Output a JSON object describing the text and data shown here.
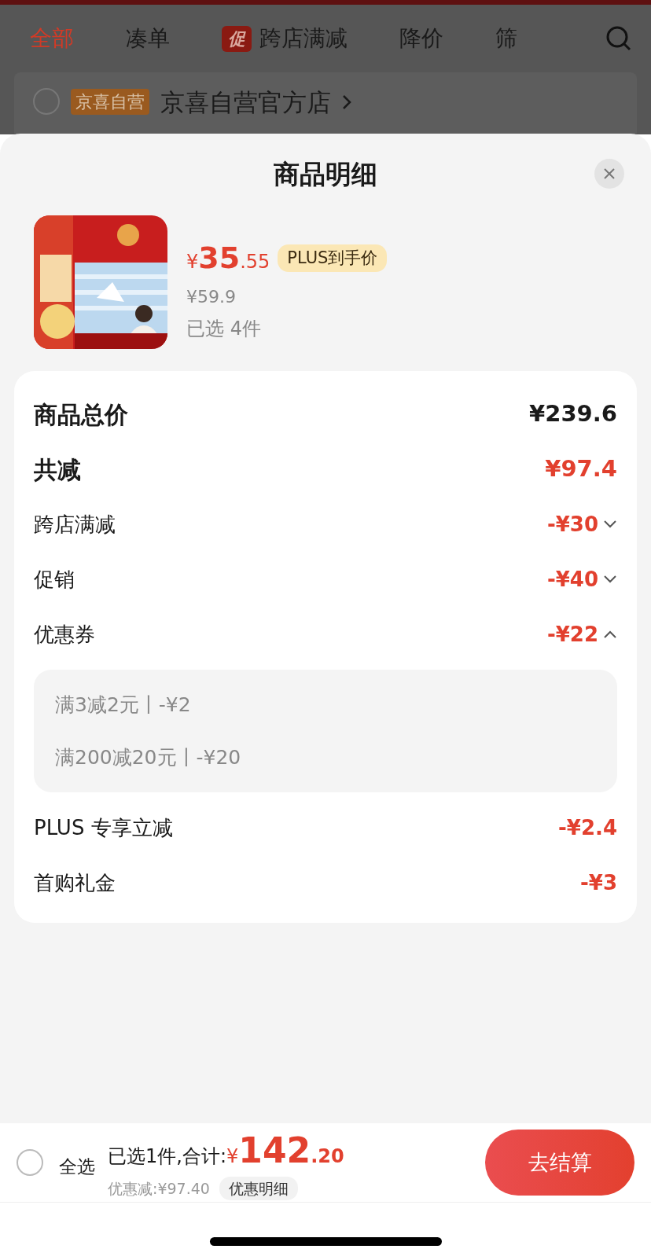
{
  "tabs": [
    {
      "label": "全部",
      "selected": true
    },
    {
      "label": "凑单",
      "selected": false
    },
    {
      "label": "跨店满减",
      "badge": "促",
      "selected": false
    },
    {
      "label": "降价",
      "selected": false
    },
    {
      "label": "筛",
      "selected": false
    }
  ],
  "store": {
    "checked": false,
    "badge": "京喜自营",
    "name": "京喜自营官方店"
  },
  "sheet": {
    "title": "商品明细",
    "product": {
      "kind": "picture",
      "price_symbol": "¥",
      "price_integer": "35",
      "price_decimal": ".55",
      "price_tag": "PLUS到手价",
      "original_price": "¥59.9",
      "quantity": "已选 4件"
    },
    "rows": [
      {
        "kind": "total",
        "label": "商品总价",
        "amount": "¥239.6"
      },
      {
        "kind": "discount-total",
        "label": "共减",
        "amount": "¥97.4"
      },
      {
        "kind": "item",
        "label": "跨店满减",
        "amount": "-¥30",
        "expanded": false
      },
      {
        "kind": "item",
        "label": "促销",
        "amount": "-¥40",
        "expanded": false
      },
      {
        "kind": "item",
        "label": "优惠券",
        "amount": "-¥22",
        "expanded": true,
        "details": [
          "满3减2元丨-¥2",
          "满200减20元丨-¥20"
        ]
      },
      {
        "kind": "plain",
        "label": "PLUS 专享立减",
        "amount": "-¥2.4"
      },
      {
        "kind": "plain",
        "label": "首购礼金",
        "amount": "-¥3"
      }
    ]
  },
  "bottom_bar": {
    "select_all": {
      "label": "全选",
      "checked": false
    },
    "summary": "已选1件,合计:",
    "total_symbol": "¥",
    "total_integer": "142",
    "total_decimal": ".20",
    "discount": "优惠减:¥97.40",
    "detail_button": "优惠明细",
    "checkout_button": "去结算"
  }
}
